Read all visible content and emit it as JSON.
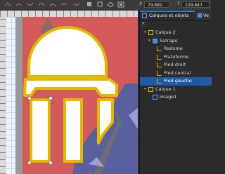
{
  "toolbar": {
    "coord_x_label": "X",
    "coord_x_value": "79,682",
    "coord_y_label": "Y",
    "coord_y_value": "109,847"
  },
  "panel": {
    "tab_layers_label": "Calques et objets",
    "tab_layers_close": "×",
    "tab_next_label": "Ve",
    "tree": [
      {
        "label": "Calque 2",
        "icon": "layer-icon",
        "expanded": true,
        "level": 0
      },
      {
        "label": "Satrape",
        "icon": "folder-icon",
        "expanded": true,
        "level": 1
      },
      {
        "label": "Radome",
        "icon": "shape-icon",
        "level": 2
      },
      {
        "label": "Plateforme",
        "icon": "shape-icon",
        "level": 2
      },
      {
        "label": "Pied droit",
        "icon": "shape-icon",
        "level": 2
      },
      {
        "label": "Pied central",
        "icon": "shape-icon",
        "level": 2
      },
      {
        "label": "Pied gauche",
        "icon": "shape-icon",
        "level": 2,
        "selected": true
      },
      {
        "label": "Calque 1",
        "icon": "layer-icon",
        "expanded": true,
        "level": 0
      },
      {
        "label": "image1",
        "icon": "image-icon",
        "level": 1
      }
    ]
  },
  "colors": {
    "accent": "#1f5aa6",
    "shape_stroke": "#e5b800",
    "shape_fill": "#ffffff",
    "map_red": "#d25a5a"
  }
}
